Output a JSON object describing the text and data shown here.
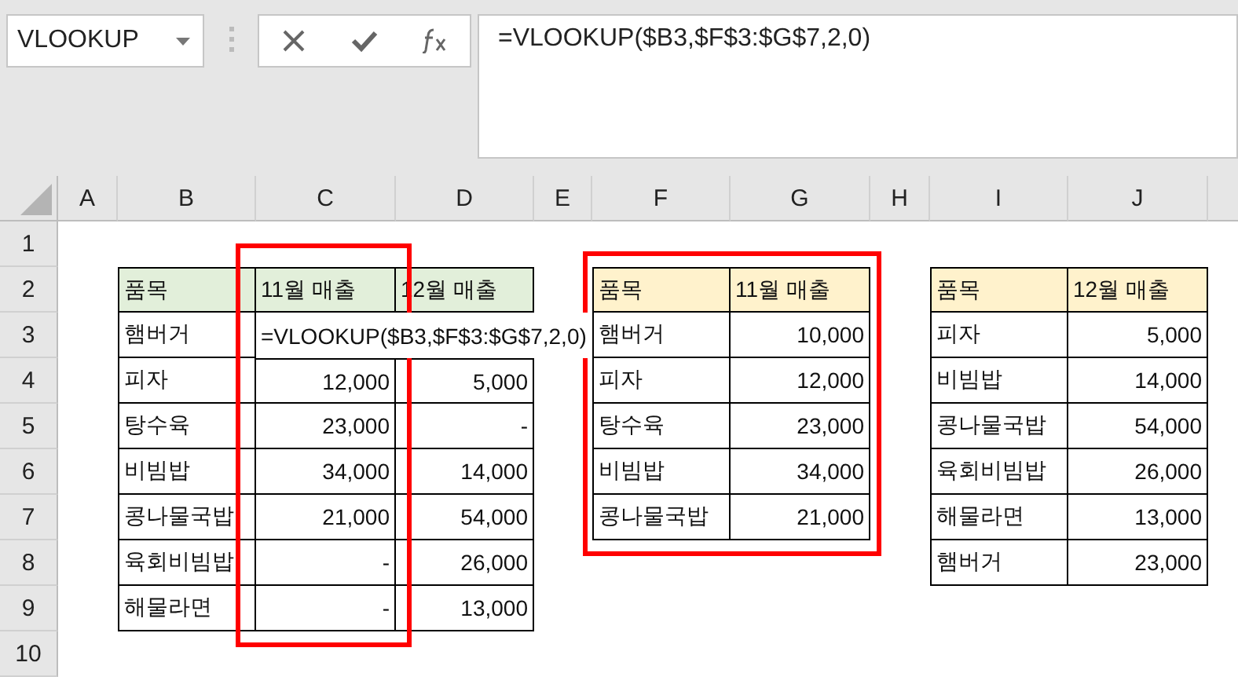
{
  "name_box": {
    "value": "VLOOKUP"
  },
  "formula_bar": {
    "value": "=VLOOKUP($B3,$F$3:$G$7,2,0)"
  },
  "columns": [
    "A",
    "B",
    "C",
    "D",
    "E",
    "F",
    "G",
    "H",
    "I",
    "J"
  ],
  "rows": [
    "1",
    "2",
    "3",
    "4",
    "5",
    "6",
    "7",
    "8",
    "9",
    "10"
  ],
  "tables": [
    {
      "color": "#e2efda",
      "header": [
        "품목",
        "11월 매출",
        "12월 매출"
      ],
      "rows": [
        {
          "cells": [
            "햄버거",
            "=VLOOKUP($B3,$F$3:$G$7,2,0)"
          ],
          "editing": true
        },
        {
          "cells": [
            "피자",
            "12,000",
            "5,000"
          ],
          "editing": false
        },
        {
          "cells": [
            "탕수육",
            "23,000",
            "-"
          ],
          "editing": false
        },
        {
          "cells": [
            "비빔밥",
            "34,000",
            "14,000"
          ],
          "editing": false
        },
        {
          "cells": [
            "콩나물국밥",
            "21,000",
            "54,000"
          ],
          "editing": false
        },
        {
          "cells": [
            "육회비빔밥",
            "-",
            "26,000"
          ],
          "editing": false
        },
        {
          "cells": [
            "해물라면",
            "-",
            "13,000"
          ],
          "editing": false
        }
      ]
    },
    {
      "color": "#fff2cc",
      "header": [
        "품목",
        "11월 매출"
      ],
      "rows": [
        {
          "cells": [
            "햄버거",
            "10,000"
          ],
          "editing": false
        },
        {
          "cells": [
            "피자",
            "12,000"
          ],
          "editing": false
        },
        {
          "cells": [
            "탕수육",
            "23,000"
          ],
          "editing": false
        },
        {
          "cells": [
            "비빔밥",
            "34,000"
          ],
          "editing": false
        },
        {
          "cells": [
            "콩나물국밥",
            "21,000"
          ],
          "editing": false
        }
      ]
    },
    {
      "color": "#fff2cc",
      "header": [
        "품목",
        "12월 매출"
      ],
      "rows": [
        {
          "cells": [
            "피자",
            "5,000"
          ],
          "editing": false
        },
        {
          "cells": [
            "비빔밥",
            "14,000"
          ],
          "editing": false
        },
        {
          "cells": [
            "콩나물국밥",
            "54,000"
          ],
          "editing": false
        },
        {
          "cells": [
            "육회비빔밥",
            "26,000"
          ],
          "editing": false
        },
        {
          "cells": [
            "해물라면",
            "13,000"
          ],
          "editing": false
        },
        {
          "cells": [
            "햄버거",
            "23,000"
          ],
          "editing": false
        }
      ]
    }
  ]
}
